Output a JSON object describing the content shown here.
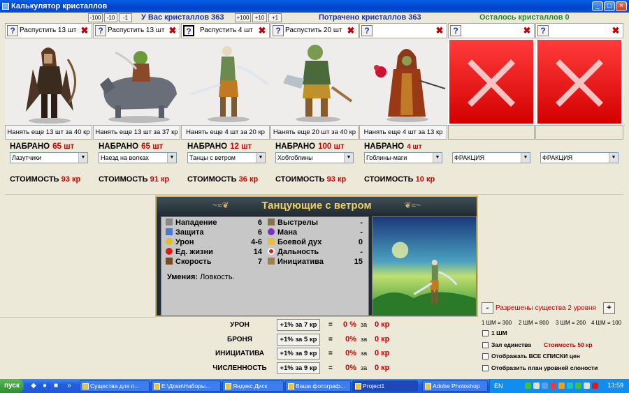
{
  "window": {
    "title": "Калькулятор кристаллов"
  },
  "top": {
    "minus_buttons": [
      "-100",
      "-10",
      "-1"
    ],
    "plus_buttons": [
      "+100",
      "+10",
      "+1"
    ],
    "have_label": "У Вас кристаллов 363",
    "spent_label": "Потрачено кристаллов 363",
    "left_label": "Осталось кристаллов 0"
  },
  "colors": {
    "have": "#1b35b0",
    "spent": "#1b35b0",
    "left": "#1e8a2a",
    "accent_red": "#d00000"
  },
  "slots": [
    {
      "dismiss": "Распустить 13 шт",
      "hire": "Нанять еще 13 шт за 40 кр",
      "collected_label": "НАБРАНО",
      "collected_value": "65 шт",
      "faction": "Лазутчики",
      "cost_label": "СТОИМОСТЬ",
      "cost_value": "93 кр",
      "creature": "hooded-archer"
    },
    {
      "dismiss": "Распустить 13 шт",
      "hire": "Нанять еще 13 шт за 37 кр",
      "collected_label": "НАБРАНО",
      "collected_value": "65 шт",
      "faction": "Наезд на волках",
      "cost_label": "СТОИМОСТЬ",
      "cost_value": "91 кр",
      "creature": "goblin-wolf-rider"
    },
    {
      "dismiss": "Распустить 4 шт",
      "hire": "Нанять еще 4 шт за 20 кр",
      "collected_label": "НАБРАНО",
      "collected_value": "12 шт",
      "faction": "Танцы с ветром",
      "cost_label": "СТОИМОСТЬ",
      "cost_value": "36 кр",
      "creature": "wind-dancer"
    },
    {
      "dismiss": "Распустить 20 шт",
      "hire": "Нанять еще 20 шт за 40 кр",
      "collected_label": "НАБРАНО",
      "collected_value": "100 шт",
      "faction": "Хобгоблины",
      "cost_label": "СТОИМОСТЬ",
      "cost_value": "93 кр",
      "creature": "hobgoblin"
    },
    {
      "dismiss": "",
      "hire": "Нанять еще 4 шт за 13 кр",
      "collected_label": "НАБРАНО",
      "collected_value": "4 шт",
      "faction": "Гоблины-маги",
      "cost_label": "СТОИМОСТЬ",
      "cost_value": "10 кр",
      "creature": "goblin-mage"
    },
    {
      "dismiss": "",
      "hire": "",
      "collected_label": "",
      "collected_value": "",
      "faction": "ФРАКЦИЯ",
      "cost_label": "",
      "cost_value": "",
      "creature": "empty"
    },
    {
      "dismiss": "",
      "hire": "",
      "collected_label": "",
      "collected_value": "",
      "faction": "ФРАКЦИЯ",
      "cost_label": "",
      "cost_value": "",
      "creature": "empty"
    }
  ],
  "unit": {
    "title": "Танцующие с ветром",
    "left_stats": [
      {
        "icon": "sword-icon",
        "label": "Нападение",
        "value": "6"
      },
      {
        "icon": "shield-icon",
        "label": "Защита",
        "value": "6"
      },
      {
        "icon": "star-icon",
        "label": "Урон",
        "value": "4-6"
      },
      {
        "icon": "heart-icon",
        "label": "Ед. жизни",
        "value": "14"
      },
      {
        "icon": "boot-icon",
        "label": "Скорость",
        "value": "7"
      }
    ],
    "right_stats": [
      {
        "icon": "arrow-icon",
        "label": "Выстрелы",
        "value": "-"
      },
      {
        "icon": "mana-icon",
        "label": "Мана",
        "value": "-"
      },
      {
        "icon": "spirit-icon",
        "label": "Боевой дух",
        "value": "0"
      },
      {
        "icon": "target-icon",
        "label": "Дальность",
        "value": "-"
      },
      {
        "icon": "hourglass-icon",
        "label": "Инициатива",
        "value": "15"
      }
    ],
    "skills_label": "Умения:",
    "skills_value": "Ловкость."
  },
  "upgrades": [
    {
      "label": "УРОН",
      "button": "+1% за 7 кр",
      "eq": "=",
      "pct": "0 %",
      "za": "за",
      "kr": "0 кр"
    },
    {
      "label": "БРОНЯ",
      "button": "+1% за 5 кр",
      "eq": "=",
      "pct": "0%",
      "za": "за",
      "kr": "0 кр"
    },
    {
      "label": "ИНИЦИАТИВА",
      "button": "+1% за 9 кр",
      "eq": "=",
      "pct": "0%",
      "za": "за",
      "kr": "0 кр"
    },
    {
      "label": "ЧИСЛЕННОСТЬ",
      "button": "+1% за 9 кр",
      "eq": "=",
      "pct": "0%",
      "za": "за",
      "kr": "0 кр"
    }
  ],
  "level": {
    "minus": "-",
    "plus": "+",
    "label": "Разрешены существа 2 уровня"
  },
  "shm": [
    "1 ШМ = 300",
    "2 ШМ = 800",
    "3 ШМ = 200",
    "4 ШМ = 100"
  ],
  "options": [
    {
      "label": "1 ШМ",
      "checked": false
    },
    {
      "label": "Зал единства",
      "checked": false,
      "extra": "Стоимость 50 кр"
    },
    {
      "label": "Отображать ВСЕ СПИСКИ цен",
      "checked": false
    },
    {
      "label": "Отобразить план уровней слоности",
      "checked": false
    }
  ],
  "taskbar": {
    "start": "пуск",
    "tasks": [
      "Существа для п...",
      "E:\\Доки\\Наборы...",
      "Яндекс.Диск",
      "Ваши фотограф...",
      "Project1",
      "Adobe Photoshop"
    ],
    "lang": "EN",
    "clock": "13:59"
  }
}
